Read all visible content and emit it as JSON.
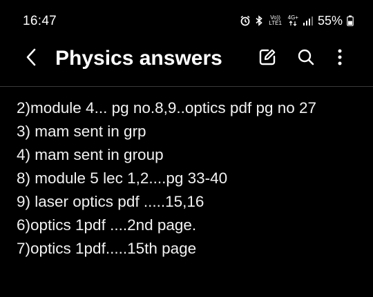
{
  "status_bar": {
    "time": "16:47",
    "volte_label": "Vo)) LTE1",
    "network_label": "4G+",
    "battery_percent": "55%",
    "icons": [
      "alarm-icon",
      "bluetooth-icon",
      "volte-icon",
      "network-activity-icon",
      "signal-icon",
      "battery-icon"
    ]
  },
  "app_bar": {
    "back_icon": "chevron-left-icon",
    "title": "Physics answers",
    "actions": [
      "edit-icon",
      "search-icon",
      "more-vert-icon"
    ]
  },
  "note": {
    "lines": [
      "2)module 4... pg no.8,9..optics pdf pg no 27",
      "3) mam sent in grp",
      "4) mam sent in group",
      "8) module 5 lec 1,2....pg 33-40",
      "9) laser optics pdf .....15,16",
      "6)optics 1pdf ....2nd page.",
      "7)optics 1pdf.....15th page"
    ]
  },
  "colors": {
    "background": "#000000",
    "text": "#ffffff",
    "divider": "#3a3a3a"
  }
}
